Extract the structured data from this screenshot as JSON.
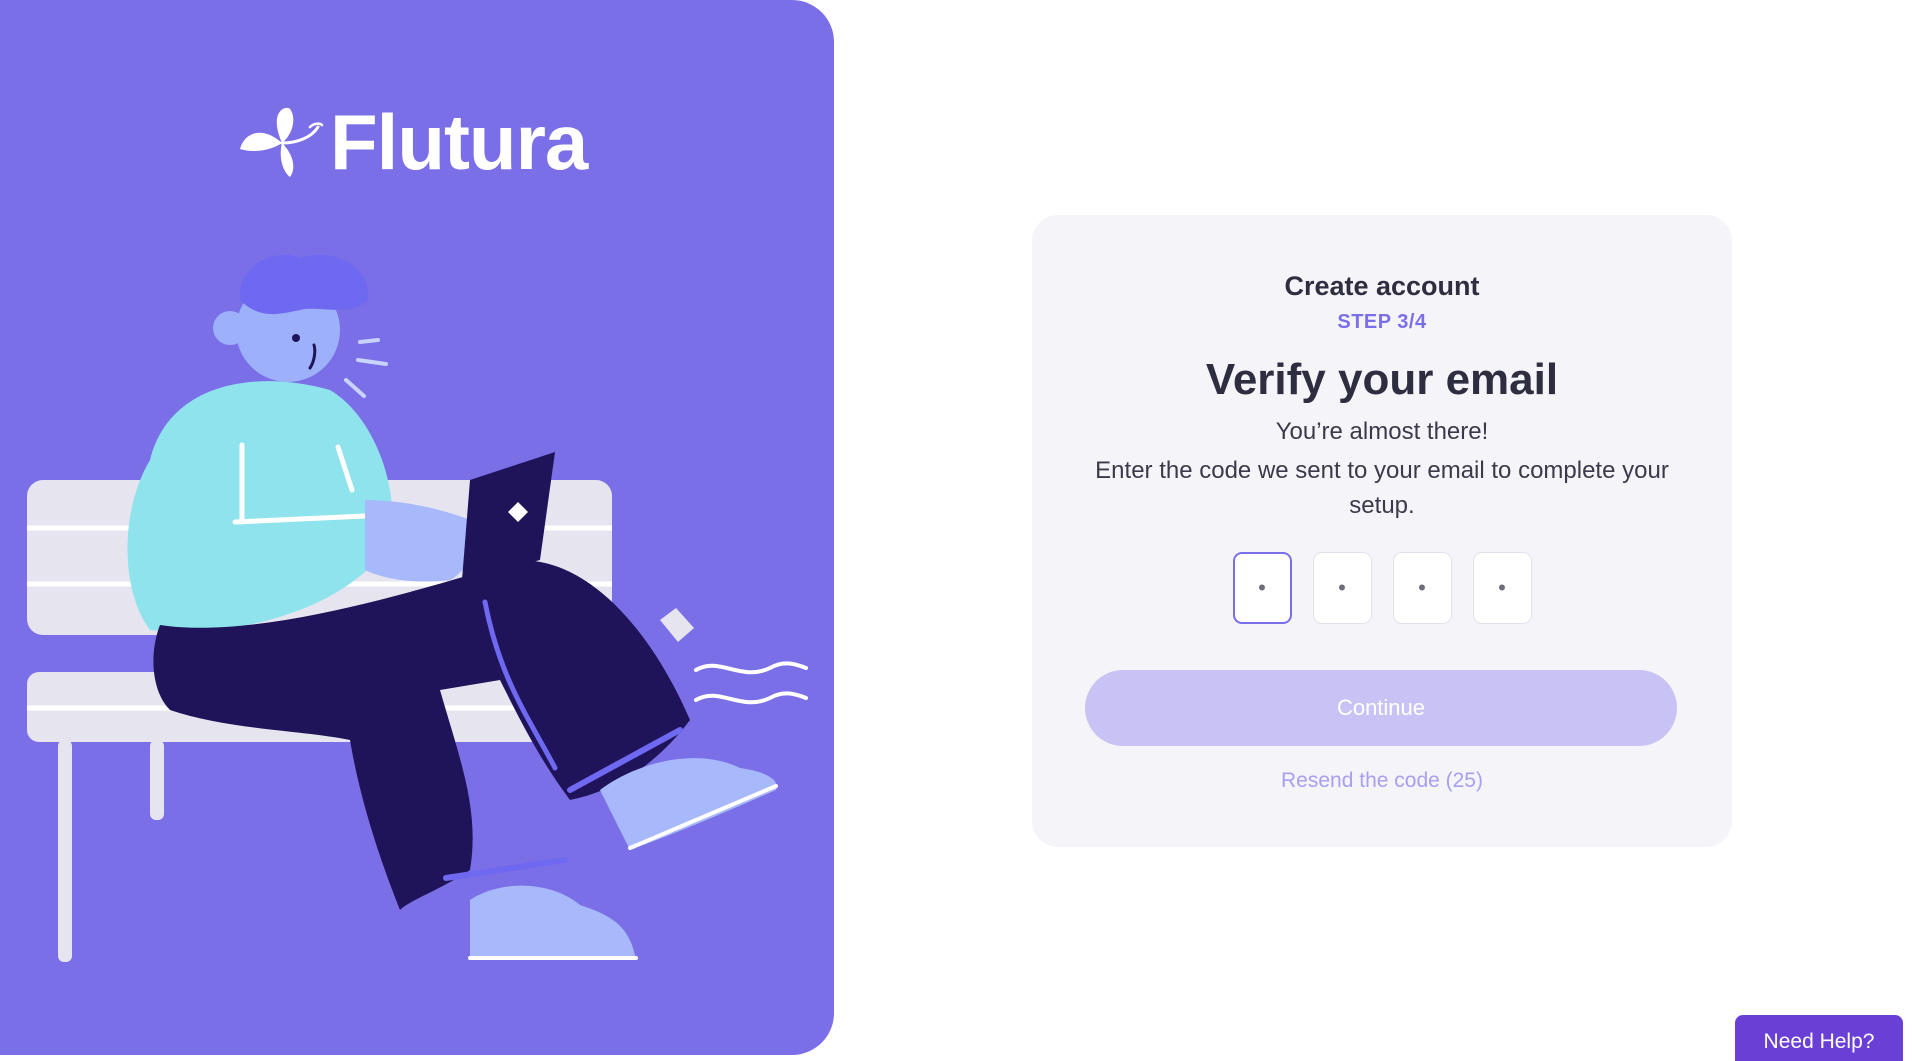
{
  "brand": {
    "name": "Flutura",
    "logo_icon": "butterfly-icon"
  },
  "colors": {
    "panel": "#7b6fe8",
    "accent": "#7b6fe8",
    "button_disabled": "#c8c3f4",
    "help_button": "#6a3fd6",
    "card_bg": "#f5f4f9"
  },
  "card": {
    "heading": "Create account",
    "step": "STEP 3/4",
    "title": "Verify your email",
    "subtitle": "You’re almost there!",
    "description": "Enter the code we sent to your email to complete your setup.",
    "code_placeholders": [
      "•",
      "•",
      "•",
      "•"
    ],
    "continue_label": "Continue",
    "resend_label": "Resend the code (25)"
  },
  "help": {
    "label": "Need Help?"
  }
}
